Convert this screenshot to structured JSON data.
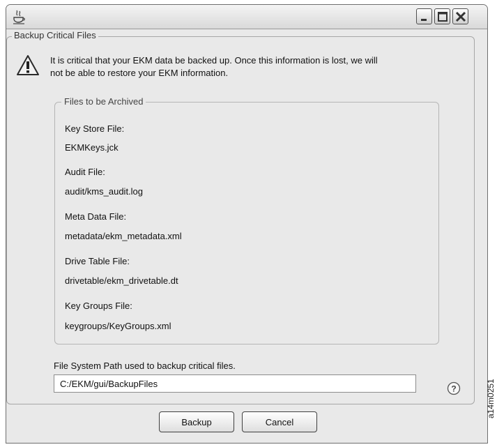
{
  "window": {
    "icon": "java-coffee-icon",
    "controls": {
      "minimize": "minimize-icon",
      "maximize": "maximize-icon",
      "close": "close-icon"
    }
  },
  "group": {
    "title": "Backup Critical Files"
  },
  "warning": {
    "icon": "warning-icon",
    "line1": "It is critical that your EKM data be backed up. Once this information is lost, we will",
    "line2": "not be able to restore your EKM information."
  },
  "archived": {
    "title": "Files to be Archived",
    "items": [
      {
        "label": "Key Store File:",
        "value": "EKMKeys.jck"
      },
      {
        "label": "Audit File:",
        "value": "audit/kms_audit.log"
      },
      {
        "label": "Meta Data File:",
        "value": "metadata/ekm_metadata.xml"
      },
      {
        "label": "Drive Table File:",
        "value": "drivetable/ekm_drivetable.dt"
      },
      {
        "label": "Key Groups File:",
        "value": "keygroups/KeyGroups.xml"
      }
    ]
  },
  "path": {
    "label": "File System Path used to backup critical files.",
    "value": "C:/EKM/gui/BackupFiles"
  },
  "help": {
    "icon": "help-icon",
    "glyph": "?"
  },
  "buttons": {
    "backup": "Backup",
    "cancel": "Cancel"
  },
  "figure_id": "a14m0251"
}
